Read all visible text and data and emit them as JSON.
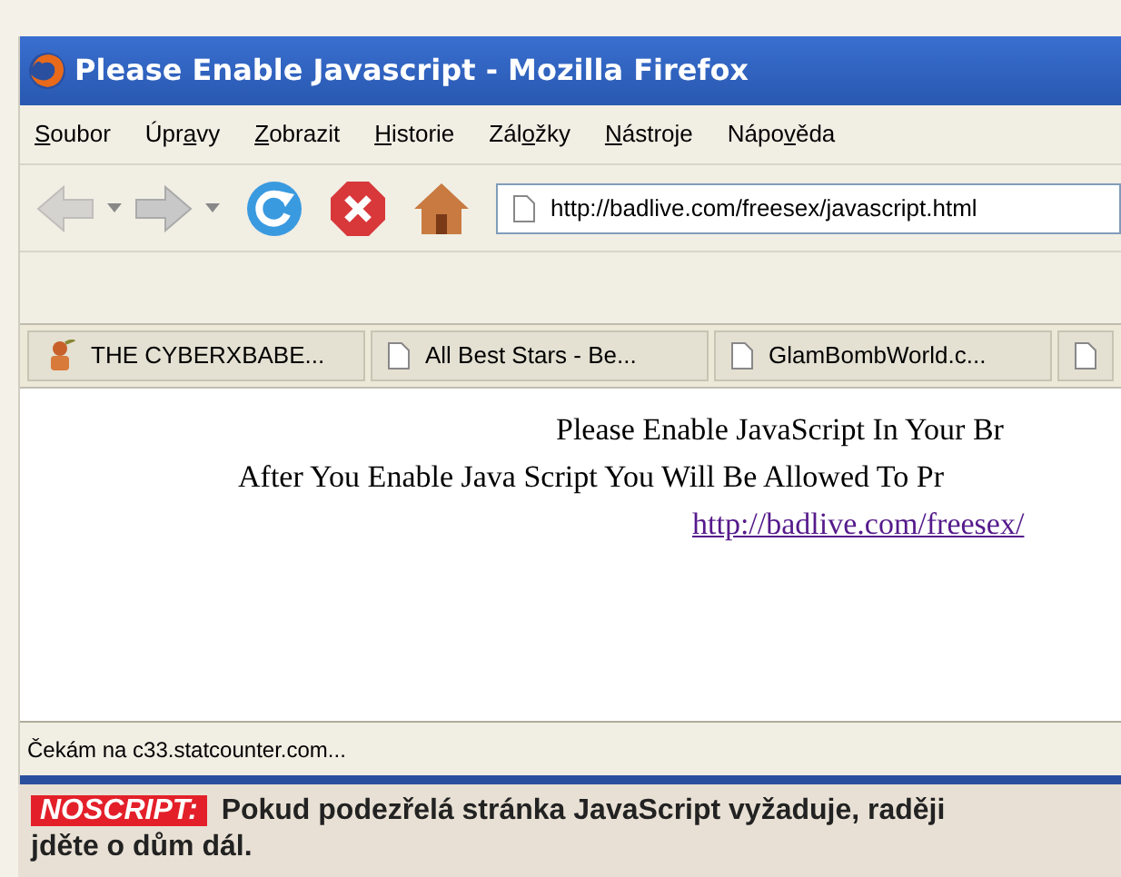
{
  "window": {
    "title": "Please Enable Javascript - Mozilla Firefox"
  },
  "menu": [
    {
      "parts": [
        {
          "text": "S",
          "underlined": true
        },
        {
          "text": "oubor",
          "underlined": false
        }
      ]
    },
    {
      "parts": [
        {
          "text": "Úpr",
          "underlined": false
        },
        {
          "text": "a",
          "underlined": true
        },
        {
          "text": "vy",
          "underlined": false
        }
      ]
    },
    {
      "parts": [
        {
          "text": "Z",
          "underlined": true
        },
        {
          "text": "obrazit",
          "underlined": false
        }
      ]
    },
    {
      "parts": [
        {
          "text": "H",
          "underlined": true
        },
        {
          "text": "istorie",
          "underlined": false
        }
      ]
    },
    {
      "parts": [
        {
          "text": "Zál",
          "underlined": false
        },
        {
          "text": "o",
          "underlined": true
        },
        {
          "text": "žky",
          "underlined": false
        }
      ]
    },
    {
      "parts": [
        {
          "text": "N",
          "underlined": true
        },
        {
          "text": "ástroje",
          "underlined": false
        }
      ]
    },
    {
      "parts": [
        {
          "text": "Nápo",
          "underlined": false
        },
        {
          "text": "v",
          "underlined": true
        },
        {
          "text": "ěda",
          "underlined": false
        }
      ]
    }
  ],
  "toolbar": {
    "back_disabled": true,
    "forward_disabled": true,
    "address": "http://badlive.com/freesex/javascript.html"
  },
  "bookmarks": [
    {
      "label": "THE CYBERXBABE...",
      "kind": "site"
    },
    {
      "label": "All Best Stars - Be...",
      "kind": "page"
    },
    {
      "label": "GlamBombWorld.c...",
      "kind": "page"
    },
    {
      "kind": "page"
    }
  ],
  "content": {
    "lines": [
      "Please Enable JavaScript In Your Br",
      "After You Enable Java Script You Will Be Allowed To Pr"
    ],
    "link": "http://badlive.com/freesex/"
  },
  "status_bar": "Čekám na c33.statcounter.com...",
  "caption": {
    "tag": "NOSCRIPT:",
    "text": "Pokud podezřelá stránka JavaScript vyžaduje, raději jděte o dům dál."
  }
}
